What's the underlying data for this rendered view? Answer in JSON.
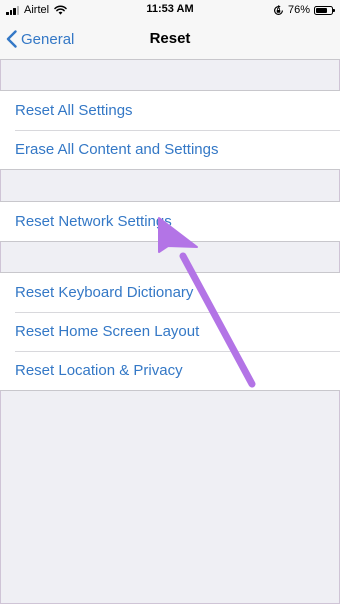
{
  "status_bar": {
    "carrier": "Airtel",
    "time": "11:53 AM",
    "battery_percent": "76%",
    "battery_level": 0.76,
    "icons": [
      "signal-icon",
      "wifi-icon",
      "orientation-lock-icon",
      "battery-icon"
    ]
  },
  "nav": {
    "back_label": "General",
    "title": "Reset",
    "icons": [
      "chevron-left-icon"
    ]
  },
  "groups": [
    {
      "items": [
        {
          "label": "Reset All Settings"
        },
        {
          "label": "Erase All Content and Settings"
        }
      ]
    },
    {
      "items": [
        {
          "label": "Reset Network Settings"
        }
      ]
    },
    {
      "items": [
        {
          "label": "Reset Keyboard Dictionary"
        },
        {
          "label": "Reset Home Screen Layout"
        },
        {
          "label": "Reset Location & Privacy"
        }
      ]
    }
  ],
  "annotation": {
    "color": "#b374e6",
    "icon": "arrow-annotation-icon"
  },
  "colors": {
    "accent": "#3478c6",
    "background": "#efeff4",
    "bar": "#f7f7f7"
  }
}
